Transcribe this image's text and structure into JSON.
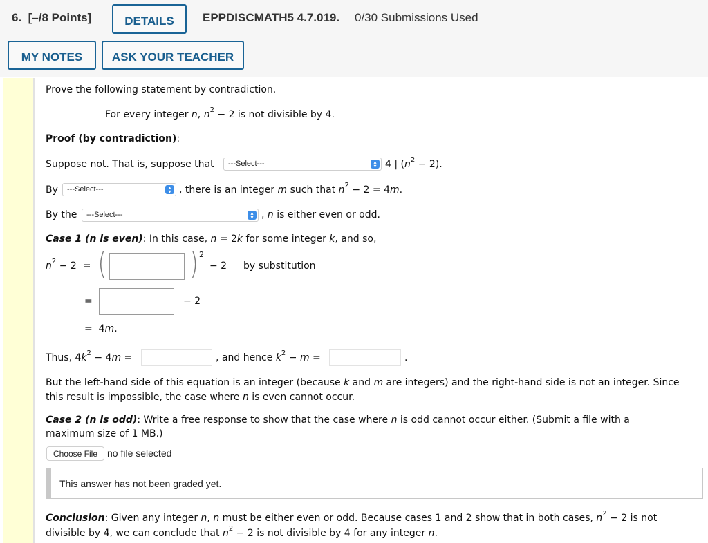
{
  "header": {
    "question_number": "6.",
    "points": "[–/8 Points]",
    "details_label": "DETAILS",
    "problem_code": "EPPDISCMATH5 4.7.019.",
    "submissions": "0/30 Submissions Used",
    "my_notes_label": "MY NOTES",
    "ask_teacher_label": "ASK YOUR TEACHER"
  },
  "problem": {
    "instruction": "Prove the following statement by contradiction.",
    "statement_prefix": "For every integer ",
    "statement_n": "n",
    "statement_mid": ", ",
    "statement_n2": "n",
    "statement_exp": "2",
    "statement_suffix": " − 2 is not divisible by 4.",
    "proof_heading": "Proof (by contradiction)",
    "proof_colon": ":"
  },
  "line1": {
    "prefix": "Suppose not. That is, suppose that",
    "select_value": "---Select---",
    "suffix_a": "4 | (",
    "suffix_n": "n",
    "suffix_exp": "2",
    "suffix_b": " − 2)."
  },
  "line2": {
    "prefix": "By",
    "select_value": "---Select---",
    "suffix_a": ", there is an integer ",
    "suffix_m": "m",
    "suffix_b": " such that ",
    "suffix_n": "n",
    "suffix_exp": "2",
    "suffix_c": " − 2 = 4",
    "suffix_m2": "m",
    "suffix_d": "."
  },
  "line3": {
    "prefix": "By the",
    "select_value": "---Select---",
    "suffix_a": ", ",
    "suffix_n": "n",
    "suffix_b": " is either even or odd."
  },
  "case1": {
    "heading": "Case 1 (n is even)",
    "text_a": ": In this case, ",
    "n": "n",
    "text_b": " = 2",
    "k": "k",
    "text_c": " for some integer ",
    "k2": "k",
    "text_d": ", and so,",
    "eq_lhs_n": "n",
    "eq_lhs_exp": "2",
    "eq_lhs_rest": " − 2  =",
    "paren_exp": "2",
    "minus2": "− 2",
    "by_sub": "by substitution",
    "eq2_equals": "=",
    "eq2_minus2": "− 2",
    "eq3": "=  4",
    "eq3_m": "m",
    "eq3_dot": ".",
    "input1_value": "",
    "input2_value": ""
  },
  "thus": {
    "text_a": "Thus, 4",
    "k": "k",
    "exp": "2",
    "text_b": " − 4",
    "m": "m",
    "text_c": " =",
    "input1_value": "",
    "text_d": ", and hence ",
    "k2": "k",
    "exp2": "2",
    "text_e": " − ",
    "m2": "m",
    "text_f": " =",
    "input2_value": "",
    "text_g": "."
  },
  "but": {
    "line1_a": "But the left-hand side of this equation is an integer (because ",
    "k": "k",
    "line1_b": " and ",
    "m": "m",
    "line1_c": " are integers) and the right-hand side is not an integer. Since",
    "line2_a": "this result is impossible, the case where ",
    "n": "n",
    "line2_b": " is even cannot occur."
  },
  "case2": {
    "heading": "Case 2 (n is odd)",
    "text_a": ": Write a free response to show that the case where ",
    "n": "n",
    "text_b": " is odd cannot occur either. (Submit a file with a",
    "line2": "maximum size of 1 MB.)",
    "choose_file_label": "Choose File",
    "file_status": "no file selected",
    "graded_status": "This answer has not been graded yet."
  },
  "conclusion": {
    "heading": "Conclusion",
    "text_a": ": Given any integer ",
    "n1": "n",
    "text_b": ", ",
    "n2": "n",
    "text_c": " must be either even or odd. Because cases 1 and 2 show that in both cases, ",
    "n3": "n",
    "exp1": "2",
    "text_d": " − 2 is not",
    "line2_a": "divisible by 4, we can conclude that ",
    "n4": "n",
    "exp2": "2",
    "line2_b": " − 2 is not divisible by 4 for any integer ",
    "n5": "n",
    "line2_c": "."
  },
  "colors": {
    "accent": "#1a6496",
    "sidebar_yellow": "#ffffd6",
    "select_arrow": "#3d8ee8"
  }
}
